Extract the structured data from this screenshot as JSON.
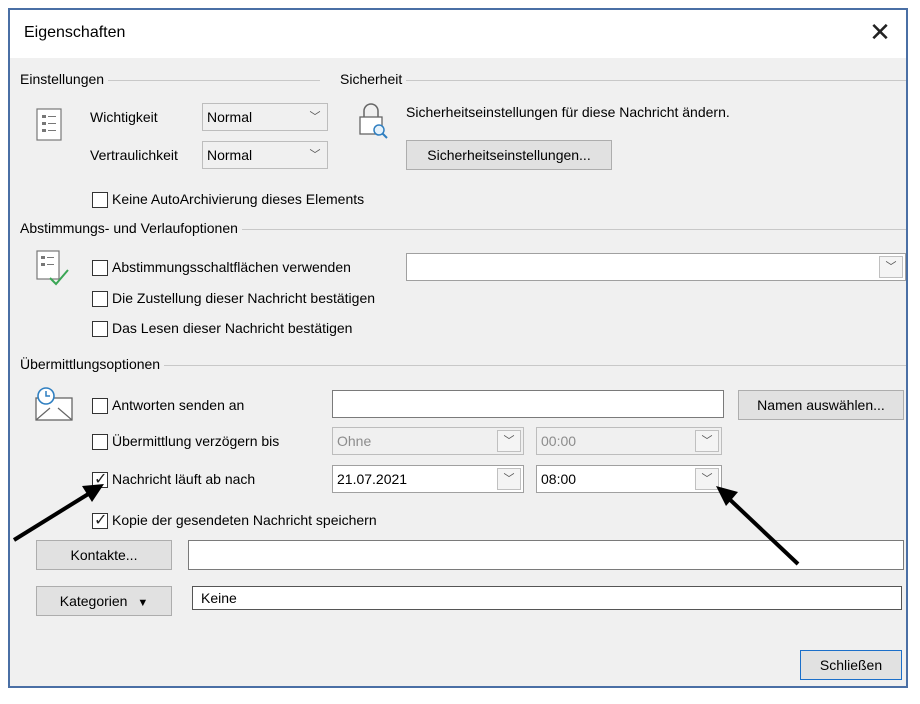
{
  "window": {
    "title": "Eigenschaften",
    "close_glyph": "✕"
  },
  "settings": {
    "heading": "Einstellungen",
    "importance_label": "Wichtigkeit",
    "importance_value": "Normal",
    "confidentiality_label": "Vertraulichkeit",
    "confidentiality_value": "Normal",
    "no_autoarchive_label": "Keine AutoArchivierung dieses Elements"
  },
  "security": {
    "heading": "Sicherheit",
    "description": "Sicherheitseinstellungen für diese Nachricht ändern.",
    "button_label": "Sicherheitseinstellungen..."
  },
  "voting": {
    "heading": "Abstimmungs- und Verlaufoptionen",
    "use_voting_label": "Abstimmungsschaltflächen verwenden",
    "voting_value": "",
    "delivery_receipt_label": "Die Zustellung dieser Nachricht bestätigen",
    "read_receipt_label": "Das Lesen dieser Nachricht bestätigen"
  },
  "delivery": {
    "heading": "Übermittlungsoptionen",
    "replies_label": "Antworten senden an",
    "replies_value": "",
    "select_names_label": "Namen auswählen...",
    "delay_label": "Übermittlung verzögern bis",
    "delay_date": "Ohne",
    "delay_time": "00:00",
    "expires_label": "Nachricht läuft ab nach",
    "expires_date": "21.07.2021",
    "expires_time": "08:00",
    "save_copy_label": "Kopie der gesendeten Nachricht speichern"
  },
  "contacts": {
    "button_label": "Kontakte...",
    "value": ""
  },
  "categories": {
    "button_label": "Kategorien",
    "value": "Keine"
  },
  "footer": {
    "close_label": "Schließen"
  },
  "icons": {
    "settings": "list-icon",
    "security": "lock-icon",
    "voting": "checklist-icon",
    "delivery": "envelope-clock-icon",
    "annotation": "arrow-annotation"
  }
}
